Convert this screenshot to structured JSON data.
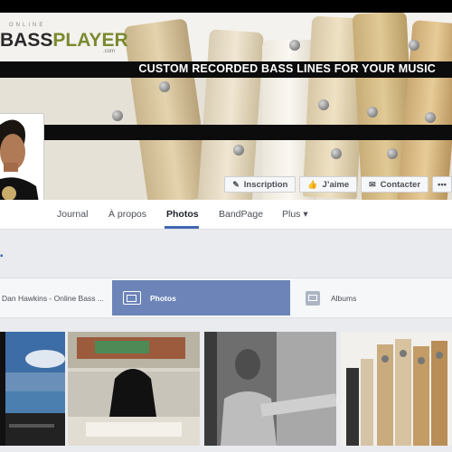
{
  "cover": {
    "logo_prefix": "ONLINE",
    "logo_bass": "BASS",
    "logo_player": "PLAYER",
    "logo_suffix": ".com",
    "tagline": "CUSTOM RECORDED BASS LINES FOR YOUR MUSIC",
    "buttons": [
      {
        "label": "Inscription",
        "icon": "pencil-icon"
      },
      {
        "label": "J’aime",
        "icon": "thumbs-up-icon"
      },
      {
        "label": "Contacter",
        "icon": "chat-icon"
      },
      {
        "label": "•••",
        "icon": "more-icon"
      }
    ]
  },
  "nav": {
    "items": [
      "Journal",
      "À propos",
      "Photos",
      "BandPage",
      "Plus ▾"
    ],
    "active": "Photos"
  },
  "photos_tabs": [
    {
      "label": "Dan Hawkins - Online Bass ...",
      "icon": null
    },
    {
      "label": "Photos",
      "icon": "photos-icon",
      "active": true
    },
    {
      "label": "Albums",
      "icon": "albums-icon"
    }
  ],
  "colors": {
    "accent": "#4267b2",
    "active_tab": "#6c84b8",
    "logo_green": "#7a8a2f"
  }
}
